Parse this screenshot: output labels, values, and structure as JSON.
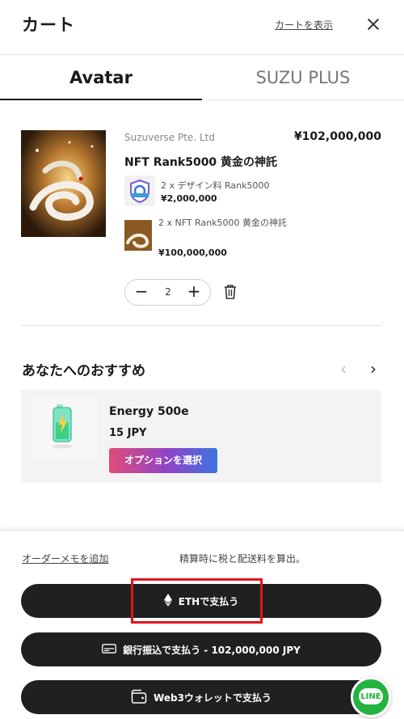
{
  "header": {
    "title": "カート",
    "view_cart": "カートを表示"
  },
  "tabs": [
    {
      "label": "Avatar",
      "active": true
    },
    {
      "label": "SUZU PLUS",
      "active": false
    }
  ],
  "cart_item": {
    "seller": "Suzuverse Pte. Ltd",
    "price": "¥102,000,000",
    "name": "NFT Rank5000 黄金の神託",
    "addons": [
      {
        "line": "2 x デザイン料 Rank5000",
        "price": "¥2,000,000"
      },
      {
        "line": "2 x NFT Rank5000 黄金の神託",
        "price": "¥100,000,000"
      }
    ],
    "quantity": "2",
    "qty_minus": "−",
    "qty_plus": "+"
  },
  "recommendations": {
    "title": "あなたへのおすすめ",
    "prev": "‹",
    "next": "›",
    "items": [
      {
        "name": "Energy 500e",
        "price": "15 JPY",
        "option_button": "オプションを選択"
      }
    ]
  },
  "footer": {
    "order_memo": "オーダーメモを追加",
    "tax_note": "精算時に税と配送料を算出。",
    "pay_eth": "ETHで支払う",
    "pay_bank": "銀行振込で支払う - 102,000,000 JPY",
    "pay_web3": "Web3ウォレットで支払う"
  },
  "line_chat": {
    "label": "LINE"
  },
  "colors": {
    "accent_dark": "#202020",
    "highlight": "#e3131b",
    "line_green": "#23b43f",
    "option_gradient": [
      "#e04c77",
      "#8e44c9",
      "#3e74e0"
    ]
  },
  "icons": [
    "close-icon",
    "trash-icon",
    "ethereum-icon",
    "bank-card-icon",
    "wallet-icon",
    "chevron-left-icon",
    "chevron-right-icon",
    "line-chat-icon"
  ]
}
